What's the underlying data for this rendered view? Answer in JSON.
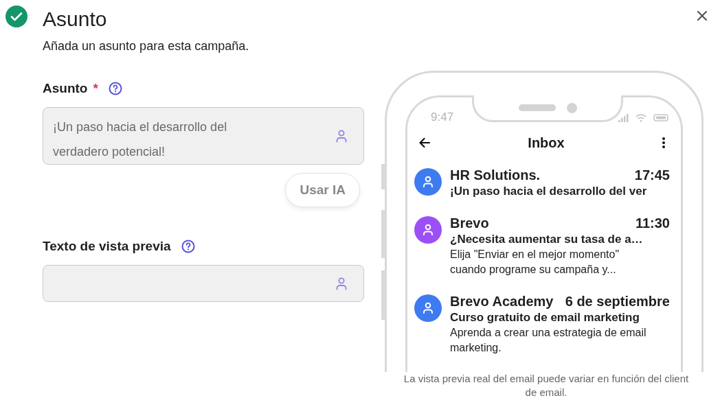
{
  "header": {
    "title": "Asunto",
    "subtitle": "Añada un asunto para esta campaña.",
    "completed": true
  },
  "fields": [
    {
      "label": "Asunto",
      "required_mark": "*",
      "value": "¡Un paso hacia el desarrollo del verdadero potencial!",
      "action": "Usar IA"
    },
    {
      "label": "Texto de vista previa"
    }
  ],
  "phone": {
    "time": "9:47",
    "title": "Inbox",
    "emails": [
      {
        "sender": "HR Solutions.",
        "time": "17:45",
        "subject": "¡Un paso hacia el desarrollo del ver",
        "color": "#3f7bf0"
      },
      {
        "sender": "Brevo",
        "time": "11:30",
        "subject": "¿Necesita aumentar su tasa de a…",
        "body": "Elija \"Enviar en el mejor momento\" cuando programe su campaña y...",
        "color": "#9b4ff5"
      },
      {
        "sender": "Brevo Academy",
        "time": "6 de septiembre",
        "subject": "Curso gratuito de email marketing",
        "body": "Aprenda a crear una estrategia de email marketing.",
        "color": "#3f7bf0"
      }
    ]
  },
  "caption_lines": [
    "La vista previa real del email puede variar en función del client",
    "de email."
  ]
}
